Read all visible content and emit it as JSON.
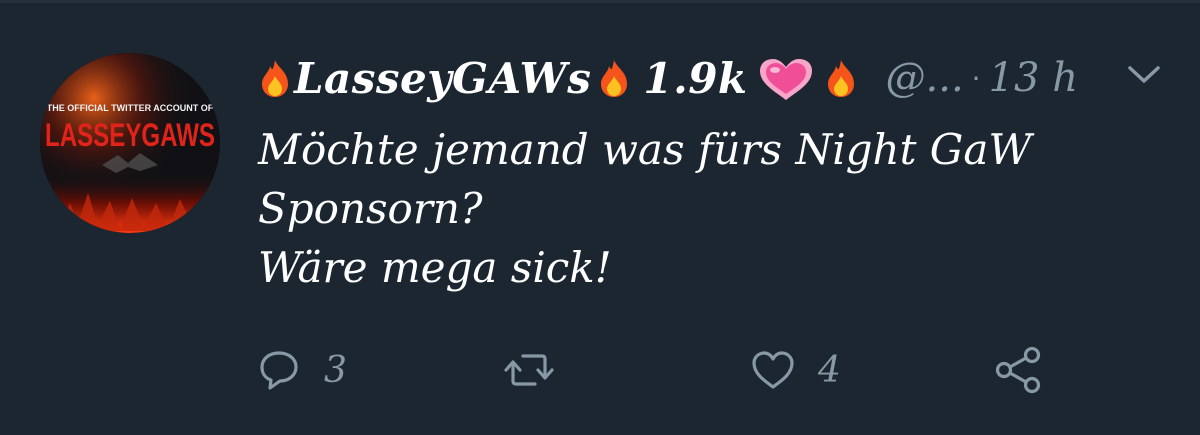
{
  "tweet": {
    "avatar": {
      "top_text": "THE OFFICIAL TWITTER ACCOUNT OF",
      "main_text": "LASSEYGAWS"
    },
    "display_name": "LasseyGAWs",
    "follower_count": "1.9k",
    "handle": "@...",
    "separator": "·",
    "time": "13 h",
    "lines": [
      "Möchte jemand was fürs Night GaW",
      "Sponsorn?",
      "Wäre mega sick!"
    ],
    "actions": {
      "reply_count": "3",
      "retweet_count": "",
      "like_count": "4"
    }
  },
  "colors": {
    "background": "#1b2631",
    "secondary_text": "#8899a6",
    "primary_text": "#ffffff"
  },
  "icons": [
    "fire-icon",
    "growing-heart-icon",
    "chevron-down-icon",
    "reply-icon",
    "retweet-icon",
    "like-icon",
    "share-icon"
  ]
}
